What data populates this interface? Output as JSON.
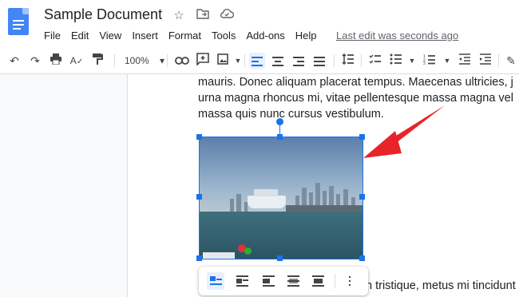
{
  "doc": {
    "title": "Sample Document",
    "last_edit": "Last edit was seconds ago"
  },
  "title_icons": [
    "star-icon",
    "move-to-folder-icon",
    "cloud-status-icon"
  ],
  "menu": [
    "File",
    "Edit",
    "View",
    "Insert",
    "Format",
    "Tools",
    "Add-ons",
    "Help"
  ],
  "toolbar": {
    "zoom": "100%",
    "zoom_arrow": "▾"
  },
  "body": {
    "line1": "mauris. Donec aliquam placerat tempus. Maecenas ultricies, j",
    "line2": "urna magna rhoncus mi, vitae pellentesque massa magna vel",
    "line3": "massa quis nunc cursus vestibulum.",
    "line_after": "n tristique, metus mi tincidunt"
  },
  "image_options": [
    "in-line",
    "wrap-text",
    "break-text",
    "behind-text",
    "in-front-of-text",
    "more-options"
  ],
  "colors": {
    "accent": "#1a73e8",
    "arrow": "#e8232a"
  }
}
